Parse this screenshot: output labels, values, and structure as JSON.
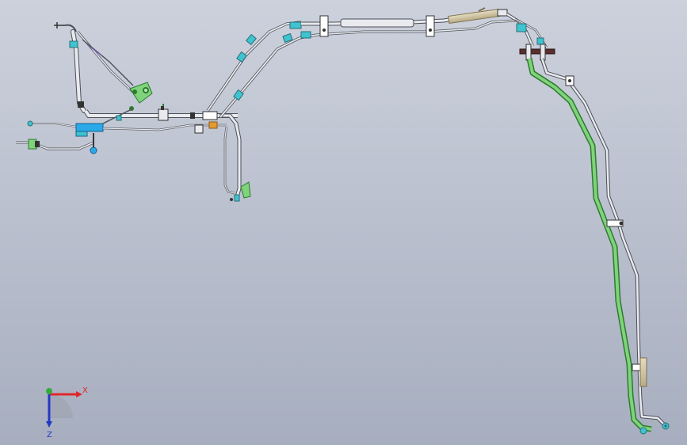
{
  "view": {
    "background_top": "#ccd1dc",
    "background_bottom": "#a7aebf"
  },
  "triad": {
    "x_label": "X",
    "z_label": "Z",
    "x_color": "#e0282c",
    "y_color": "#2fae3a",
    "z_color": "#2338c8"
  },
  "colors": {
    "pipe_gray": "#e8eaee",
    "pipe_outline": "#4b4f58",
    "pipe_green": "#7fd37a",
    "pipe_green_outline": "#2f7a31",
    "fitting_cyan": "#3fc3cf",
    "block_blue": "#2aa9e8",
    "tan_sleeve": "#cfc4a2",
    "orange_part": "#e39a32",
    "flange_dark": "#5a2e2e"
  }
}
